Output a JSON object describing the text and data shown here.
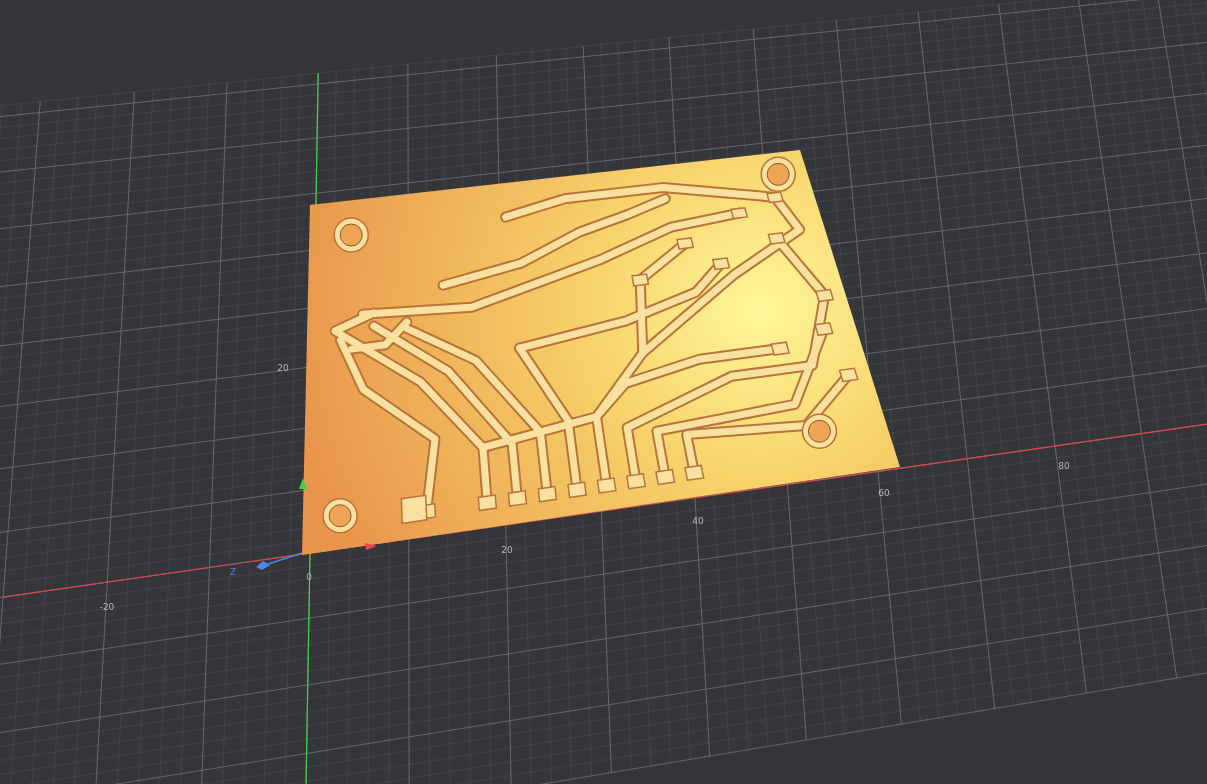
{
  "viewport": {
    "x_tick_labels": [
      "-20",
      "0",
      "20",
      "40",
      "60",
      "80"
    ],
    "y_tick_labels": [
      "20"
    ],
    "axis_name": "Z"
  }
}
